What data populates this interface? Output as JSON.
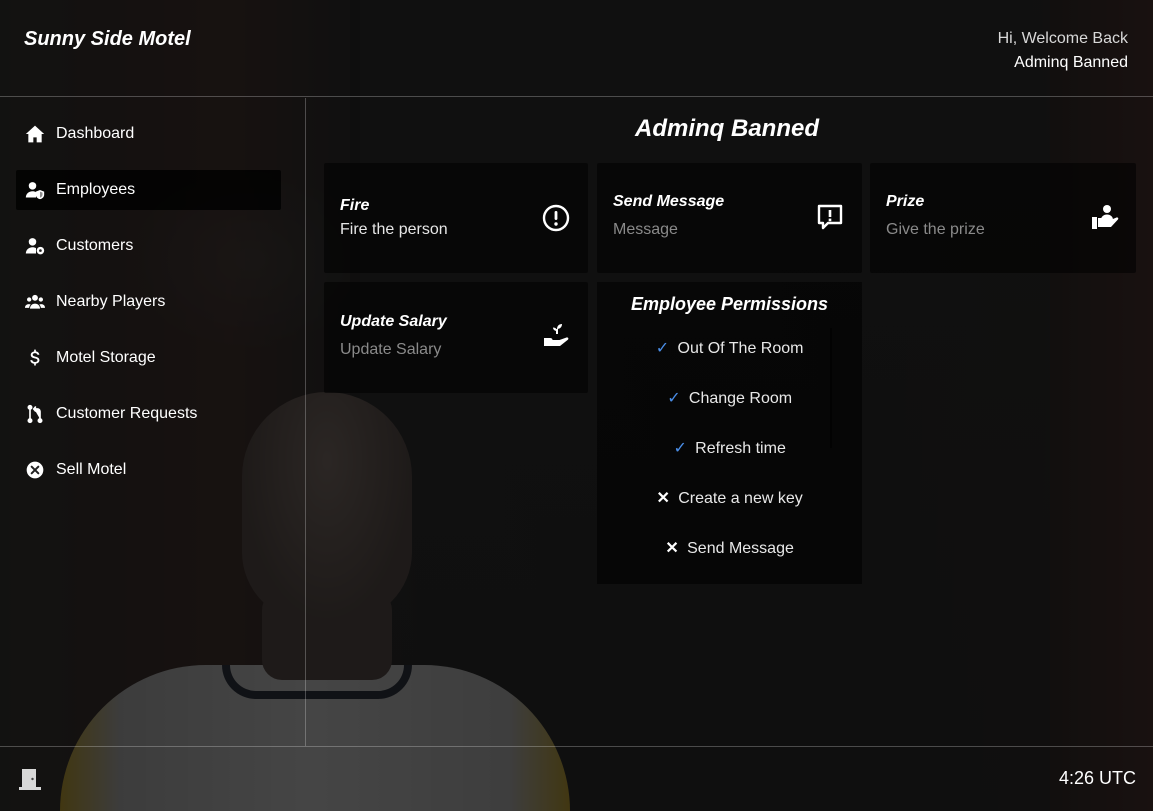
{
  "header": {
    "brand": "Sunny Side Motel",
    "greeting": "Hi, Welcome Back",
    "username": "Adminq Banned"
  },
  "sidebar": {
    "items": [
      {
        "label": "Dashboard",
        "icon": "home-icon",
        "active": false
      },
      {
        "label": "Employees",
        "icon": "user-shield-icon",
        "active": true
      },
      {
        "label": "Customers",
        "icon": "user-gear-icon",
        "active": false
      },
      {
        "label": "Nearby Players",
        "icon": "users-icon",
        "active": false
      },
      {
        "label": "Motel Storage",
        "icon": "dollar-icon",
        "active": false
      },
      {
        "label": "Customer Requests",
        "icon": "pull-request-icon",
        "active": false
      },
      {
        "label": "Sell Motel",
        "icon": "circle-x-icon",
        "active": false
      }
    ]
  },
  "main": {
    "title": "Adminq Banned",
    "cards": {
      "fire": {
        "title": "Fire",
        "subtitle": "Fire the person",
        "icon": "exclamation-circle-icon"
      },
      "send_message": {
        "title": "Send Message",
        "subtitle": "Message",
        "icon": "message-alert-icon"
      },
      "prize": {
        "title": "Prize",
        "subtitle": "Give the prize",
        "icon": "hand-holding-user-icon"
      },
      "update_salary": {
        "title": "Update Salary",
        "subtitle": "Update Salary",
        "icon": "hand-seedling-icon"
      }
    },
    "permissions": {
      "title": "Employee Permissions",
      "items": [
        {
          "label": "Out Of The Room",
          "granted": true,
          "mark": "✓"
        },
        {
          "label": "Change Room",
          "granted": true,
          "mark": "✓"
        },
        {
          "label": "Refresh time",
          "granted": true,
          "mark": "✓"
        },
        {
          "label": "Create a new key",
          "granted": false,
          "mark": "✕"
        },
        {
          "label": "Send Message",
          "granted": false,
          "mark": "✕"
        }
      ]
    }
  },
  "footer": {
    "exit_icon": "door-exit-icon",
    "clock": "4:26 UTC"
  },
  "colors": {
    "accent_check": "#4a8ee8",
    "muted_text": "#8a8a8a",
    "panel": "#000000"
  }
}
